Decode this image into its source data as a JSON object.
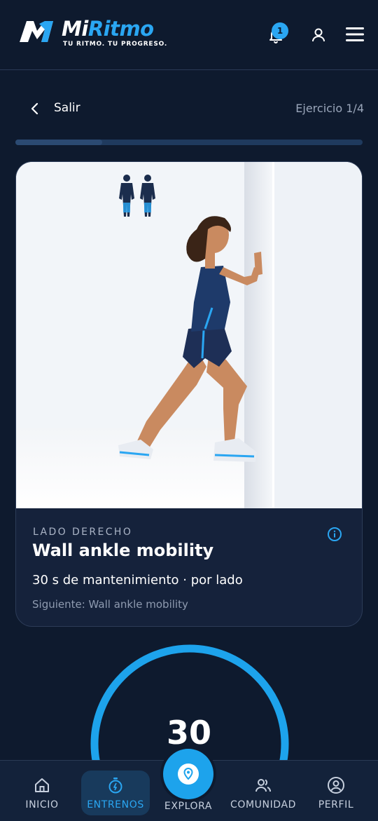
{
  "header": {
    "brand_part1": "Mi",
    "brand_part2": "Ritmo",
    "tagline": "TU RITMO. TU PROGRESO.",
    "notification_count": "1"
  },
  "workout": {
    "exit_label": "Salir",
    "progress_label": "Ejercicio 1/4",
    "progress_fraction": 0.25
  },
  "exercise": {
    "side": "LADO DERECHO",
    "title": "Wall ankle mobility",
    "meta": "30 s de mantenimiento · por lado",
    "next": "Siguiente: Wall ankle mobility"
  },
  "timer": {
    "value": "30"
  },
  "nav": {
    "inicio": "INICIO",
    "entrenos": "ENTRENOS",
    "explora": "EXPLORA",
    "comunidad": "COMUNIDAD",
    "perfil": "PERFIL"
  },
  "colors": {
    "background": "#0e1a2e",
    "accent": "#2aa6f2",
    "card": "#15223b"
  },
  "icons": [
    "logo-m-icon",
    "bell-icon",
    "user-icon",
    "menu-icon",
    "chevron-left-icon",
    "info-icon",
    "home-icon",
    "stopwatch-icon",
    "location-pin-icon",
    "users-icon",
    "profile-icon"
  ]
}
